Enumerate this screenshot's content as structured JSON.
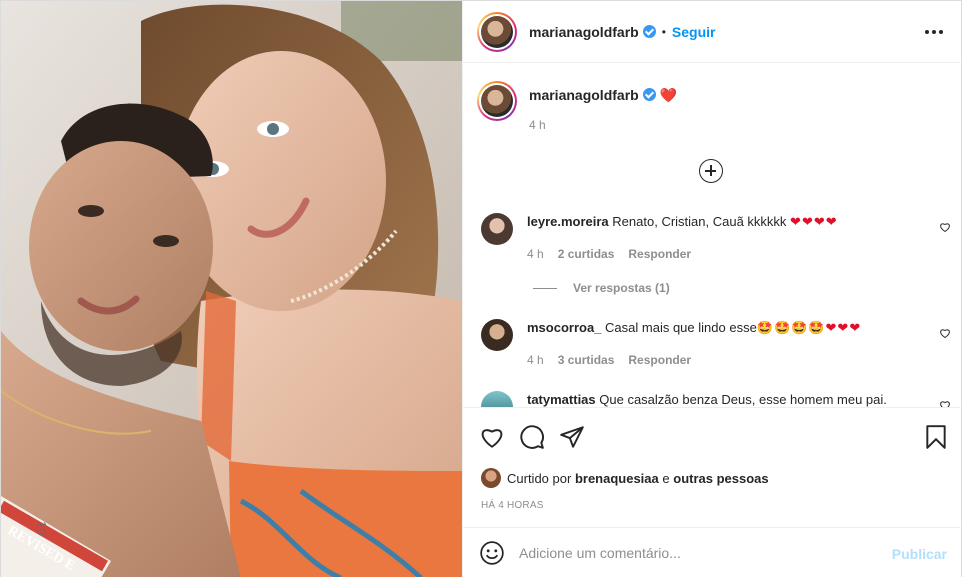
{
  "header": {
    "username": "marianagoldfarb",
    "separator": "•",
    "follow_label": "Seguir",
    "more_icon": "more-horizontal-icon"
  },
  "caption": {
    "username": "marianagoldfarb",
    "text": "❤️",
    "time": "4 h"
  },
  "comments": [
    {
      "username": "leyre.moreira",
      "text": "Renato, Cristian, Cauã kkkkkk",
      "emoji": "❤❤❤❤",
      "time": "4 h",
      "likes": "2 curtidas",
      "reply_label": "Responder"
    },
    {
      "username": "msocorroa_",
      "text": "Casal mais que lindo esse",
      "emoji": "🤩🤩🤩🤩❤❤❤",
      "time": "4 h",
      "likes": "3 curtidas",
      "reply_label": "Responder"
    },
    {
      "username": "tatymattias",
      "text": "Que casalzão benza Deus, esse homem meu pai.",
      "emoji": "",
      "time": "",
      "likes": "",
      "reply_label": ""
    }
  ],
  "replies_label": "Ver respostas (1)",
  "likes_line": {
    "prefix": "Curtido por",
    "user": "brenaquesiaa",
    "conjunction": "e",
    "others": "outras pessoas"
  },
  "posted_ago": "HÁ 4 HORAS",
  "add_comment": {
    "placeholder": "Adicione um comentário...",
    "publish_label": "Publicar"
  },
  "photo_overlay_text": {
    "date_stamp": "10",
    "book_text": "REVISED E"
  },
  "colors": {
    "accent": "#0095f6",
    "verified": "#3897f0",
    "heart": "#e0102a",
    "publish_disabled": "#b2dffc"
  }
}
